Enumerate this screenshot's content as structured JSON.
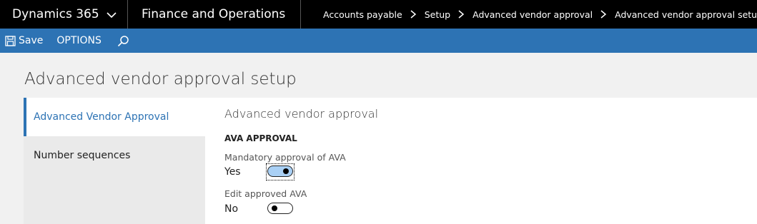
{
  "topbar": {
    "app_name": "Dynamics 365",
    "module": "Finance and Operations",
    "breadcrumbs": [
      "Accounts payable",
      "Setup",
      "Advanced vendor approval",
      "Advanced vendor approval setup"
    ]
  },
  "actionbar": {
    "save_label": "Save",
    "options_label": "OPTIONS"
  },
  "page": {
    "title": "Advanced vendor approval setup"
  },
  "leftnav": {
    "items": [
      {
        "label": "Advanced Vendor Approval",
        "active": true
      },
      {
        "label": "Number sequences",
        "active": false
      }
    ]
  },
  "panel": {
    "section_title": "Advanced vendor approval",
    "group_header": "AVA APPROVAL",
    "fields": [
      {
        "label": "Mandatory approval of AVA",
        "value": "Yes",
        "toggled": true
      },
      {
        "label": "Edit approved AVA",
        "value": "No",
        "toggled": false
      }
    ]
  },
  "colors": {
    "topbar_bg": "#000000",
    "actionbar_bg": "#2d73b4",
    "accent": "#2d73b4",
    "toggle_on_bg": "#a9d0f5"
  }
}
